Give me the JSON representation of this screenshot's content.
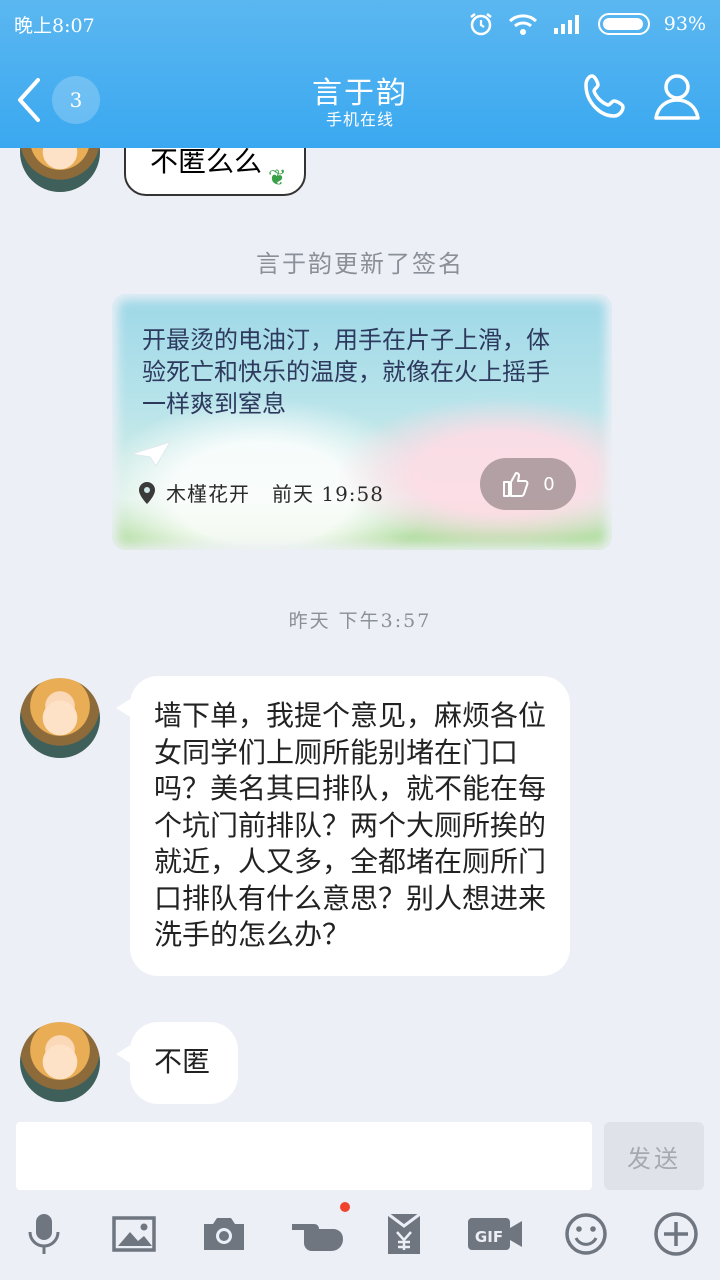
{
  "status_bar": {
    "time": "晚上8:07",
    "battery": "93%"
  },
  "header": {
    "unread_count": "3",
    "contact_name": "言于韵",
    "contact_status": "手机在线"
  },
  "messages": {
    "previous_fragment": "不匿么么",
    "signature_notice": "言于韵更新了签名",
    "signature_card": {
      "text": "开最烫的电油汀，用手在片子上滑，体验死亡和快乐的温度，就像在火上摇手一样爽到窒息",
      "location": "木槿花开",
      "time": "前天 19:58",
      "likes": "0"
    },
    "timestamp": "昨天 下午3:57",
    "message_1": "墙下单，我提个意见，麻烦各位女同学们上厕所能别堵在门口吗？美名其曰排队，就不能在每个坑门前排队？两个大厕所挨的就近，人又多，全都堵在厕所门口排队有什么意思？别人想进来洗手的怎么办？",
    "message_2": "不匿"
  },
  "composer": {
    "input_value": "",
    "send_label": "发送"
  },
  "toolbar": {
    "icons": [
      "microphone-icon",
      "image-icon",
      "camera-icon",
      "poke-icon",
      "red-packet-icon",
      "gif-icon",
      "emoji-icon",
      "plus-icon"
    ]
  },
  "colors": {
    "header": "#3aa8f0",
    "background": "#eceff6",
    "notification_dot": "#f0432e"
  }
}
